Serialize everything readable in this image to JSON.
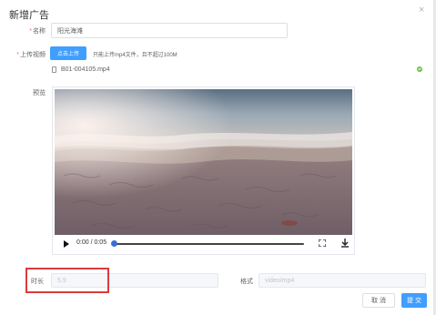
{
  "dialog": {
    "title": "新增广告",
    "close_symbol": "×"
  },
  "form": {
    "name": {
      "required_mark": "*",
      "label": "名称",
      "value": "阳光海滩"
    },
    "upload": {
      "required_mark": "*",
      "label": "上传视频",
      "button_label": "点击上传",
      "tip": "只能上传mp4文件，且不超过100M",
      "file_name": "B01-004105.mp4"
    },
    "preview": {
      "label": "预览"
    },
    "video": {
      "time": "0:00 / 0:05",
      "progress": 0
    },
    "duration": {
      "label": "时长",
      "value": "5.9"
    },
    "format": {
      "label": "格式",
      "value": "video/mp4"
    }
  },
  "footer": {
    "cancel_label": "取 消",
    "submit_label": "提 交"
  },
  "colors": {
    "primary": "#409eff",
    "highlight": "#d83c3c",
    "success": "#67c23a"
  }
}
